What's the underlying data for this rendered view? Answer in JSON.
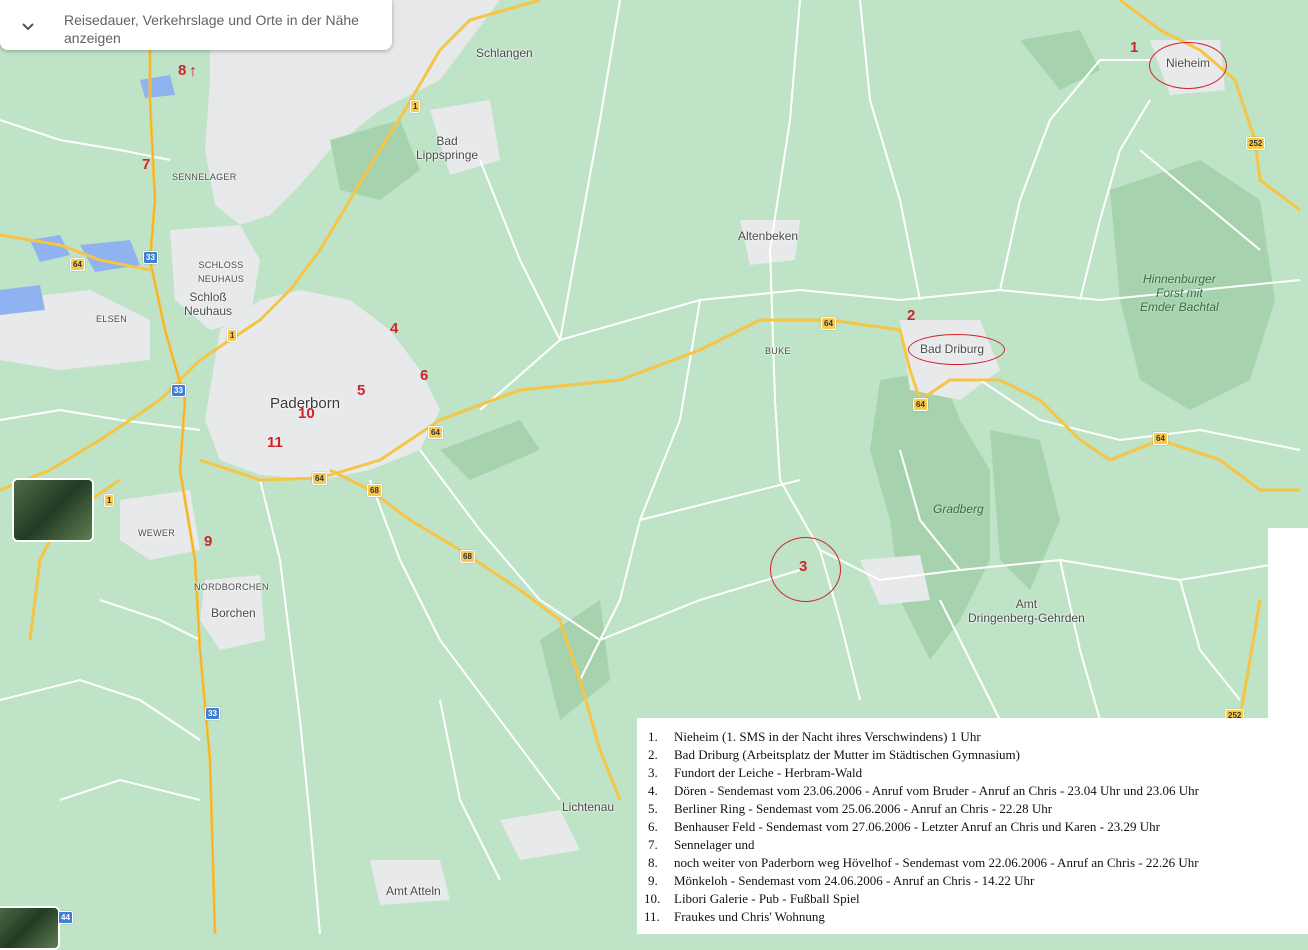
{
  "search_panel": {
    "placeholder": "Reisedauer, Verkehrslage und Orte in der Nähe anzeigen",
    "chevron_icon": "chevron-down-icon"
  },
  "places": {
    "schlangen": "Schlangen",
    "bad_lippspringe": "Bad\nLippspringe",
    "sennelager": "SENNELAGER",
    "schloss_neuhaus_caps": "SCHLOSS\nNEUHAUS",
    "schloss_neuhaus": "Schloß\nNeuhaus",
    "elsen": "ELSEN",
    "paderborn": "Paderborn",
    "wewer": "WEWER",
    "nordborchen": "NORDBORCHEN",
    "borchen": "Borchen",
    "altenbeken": "Altenbeken",
    "buke": "BUKE",
    "bad_driburg": "Bad Driburg",
    "nieheim": "Nieheim",
    "hinnenburger": "Hinnenburger\nForst mit\nEmder Bachtal",
    "gradberg": "Gradberg",
    "amt_dringenberg": "Amt\nDringenberg-Gehrden",
    "lichtenau": "Lichtenau",
    "amt_atteln": "Amt Atteln"
  },
  "road_shields": {
    "b1_top": "1",
    "b252_top": "252",
    "b64_left": "64",
    "a33_top": "33",
    "b1_mid": "1",
    "a33_mid": "33",
    "b64_center": "64",
    "b64_driburg": "64",
    "b64_south": "64",
    "b64_east": "64",
    "b68_a": "68",
    "b64_pb": "64",
    "b1_south": "1",
    "b68_b": "68",
    "a33_bottom": "33",
    "b252_bottom": "252",
    "a44": "44"
  },
  "markers": {
    "m1": "1",
    "m2": "2",
    "m3": "3",
    "m4": "4",
    "m5": "5",
    "m6": "6",
    "m7": "7",
    "m8": "8",
    "m9": "9",
    "m10": "10",
    "m11": "11",
    "arrow": "↑"
  },
  "legend": [
    {
      "num": "1.",
      "text": "Nieheim (1. SMS in der Nacht ihres Verschwindens) 1 Uhr"
    },
    {
      "num": "2.",
      "text": "Bad Driburg (Arbeitsplatz der Mutter im Städtischen Gymnasium)"
    },
    {
      "num": "3.",
      "text": "Fundort der Leiche - Herbram-Wald"
    },
    {
      "num": "4.",
      "text": "Dören - Sendemast vom 23.06.2006 - Anruf vom Bruder - Anruf an Chris - 23.04 Uhr und 23.06 Uhr"
    },
    {
      "num": "5.",
      "text": "Berliner Ring - Sendemast vom 25.06.2006 - Anruf an Chris - 22.28 Uhr"
    },
    {
      "num": "6.",
      "text": "Benhauser Feld - Sendemast vom 27.06.2006 - Letzter Anruf an Chris und Karen - 23.29 Uhr"
    },
    {
      "num": "7.",
      "text": "Sennelager und"
    },
    {
      "num": "8.",
      "text": "noch weiter von Paderborn weg Hövelhof - Sendemast vom 22.06.2006 - Anruf an Chris - 22.26 Uhr"
    },
    {
      "num": "9.",
      "text": "Mönkeloh - Sendemast vom 24.06.2006 - Anruf an Chris - 14.22 Uhr"
    },
    {
      "num": "10.",
      "text": "Libori Galerie - Pub - Fußball Spiel"
    },
    {
      "num": "11.",
      "text": "Fraukes und Chris' Wohnung"
    }
  ]
}
